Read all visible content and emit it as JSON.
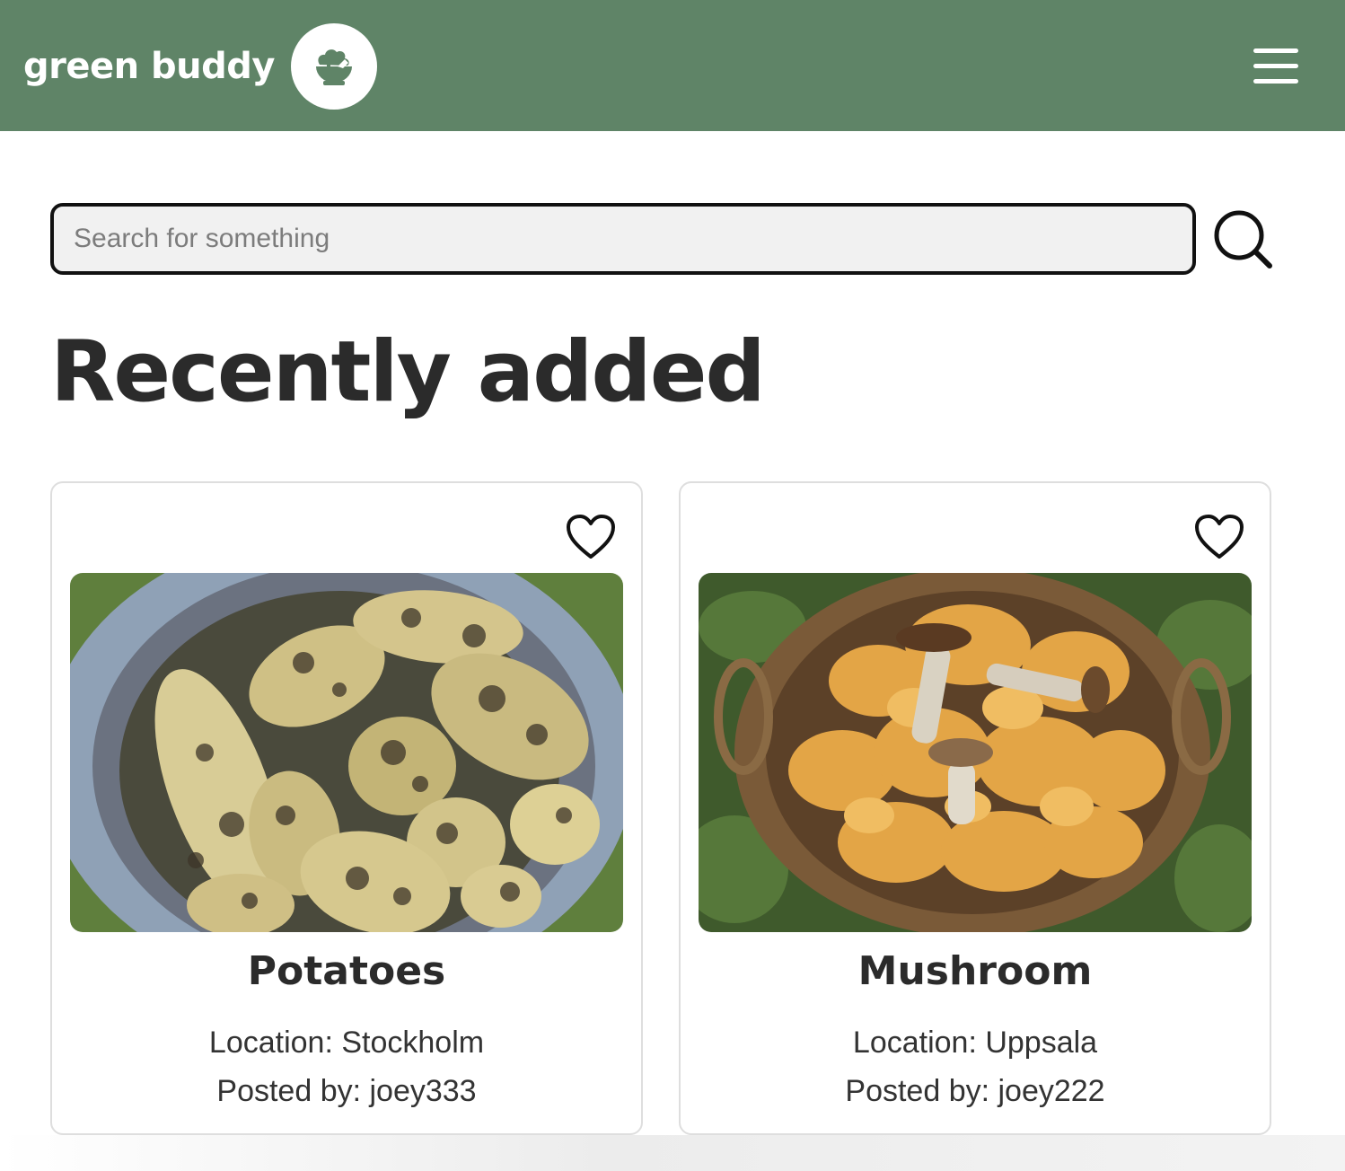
{
  "header": {
    "brand_name": "green buddy",
    "logo_icon": "salad-bowl-icon",
    "menu_icon": "hamburger-menu-icon",
    "background_color": "#5f8467"
  },
  "search": {
    "placeholder": "Search for something",
    "value": "",
    "icon": "search-icon"
  },
  "main": {
    "section_title": "Recently added",
    "cards": [
      {
        "title": "Potatoes",
        "location": "Location: Stockholm",
        "posted_by": "Posted by: joey333",
        "image": "potatoes-in-bucket-photo",
        "favorite_icon": "heart-outline-icon"
      },
      {
        "title": "Mushroom",
        "location": "Location: Uppsala",
        "posted_by": "Posted by: joey222",
        "image": "mushrooms-in-basket-photo",
        "favorite_icon": "heart-outline-icon"
      }
    ]
  }
}
